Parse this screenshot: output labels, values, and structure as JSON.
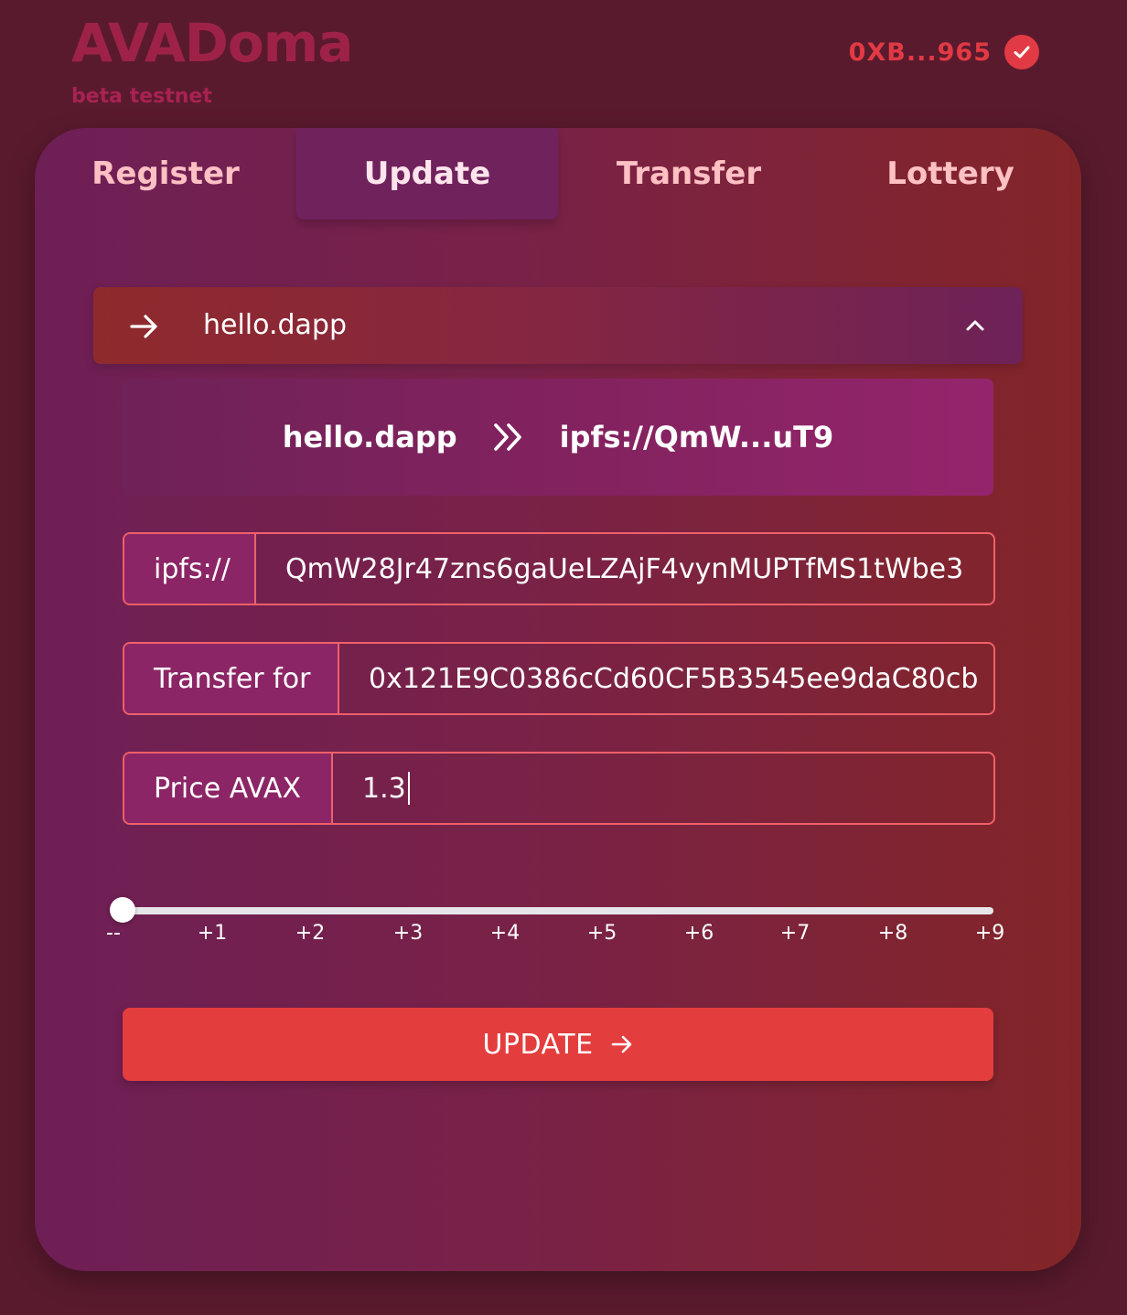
{
  "header": {
    "logo": "AVADoma",
    "subtitle": "beta testnet",
    "wallet_address": "0XB...965",
    "wallet_status_icon": "check-circle-icon"
  },
  "tabs": [
    {
      "label": "Register",
      "active": false
    },
    {
      "label": "Update",
      "active": true
    },
    {
      "label": "Transfer",
      "active": false
    },
    {
      "label": "Lottery",
      "active": false
    }
  ],
  "domain_select": {
    "selected": "hello.dapp",
    "leading_icon": "arrow-right-icon",
    "trailing_icon": "chevron-up-icon"
  },
  "mapping": {
    "name": "hello.dapp",
    "separator_icon": "double-chevron-right-icon",
    "target": "ipfs://QmW...uT9"
  },
  "fields": {
    "ipfs": {
      "label": "ipfs://",
      "value": "QmW28Jr47zns6gaUeLZAjF4vynMUPTfMS1tWbe3"
    },
    "transfer": {
      "label": "Transfer for",
      "value": "0x121E9C0386cCd60CF5B3545ee9daC80cb"
    },
    "price": {
      "label": "Price AVAX",
      "value": "1.3"
    }
  },
  "slider": {
    "ticks": [
      "--",
      "+1",
      "+2",
      "+3",
      "+4",
      "+5",
      "+6",
      "+7",
      "+8",
      "+9"
    ],
    "selected_index": 0
  },
  "submit": {
    "label": "UPDATE",
    "icon": "arrow-right-icon"
  },
  "colors": {
    "background": "#5a1a2e",
    "accent": "#e33d3e",
    "logo": "#9e2248"
  }
}
